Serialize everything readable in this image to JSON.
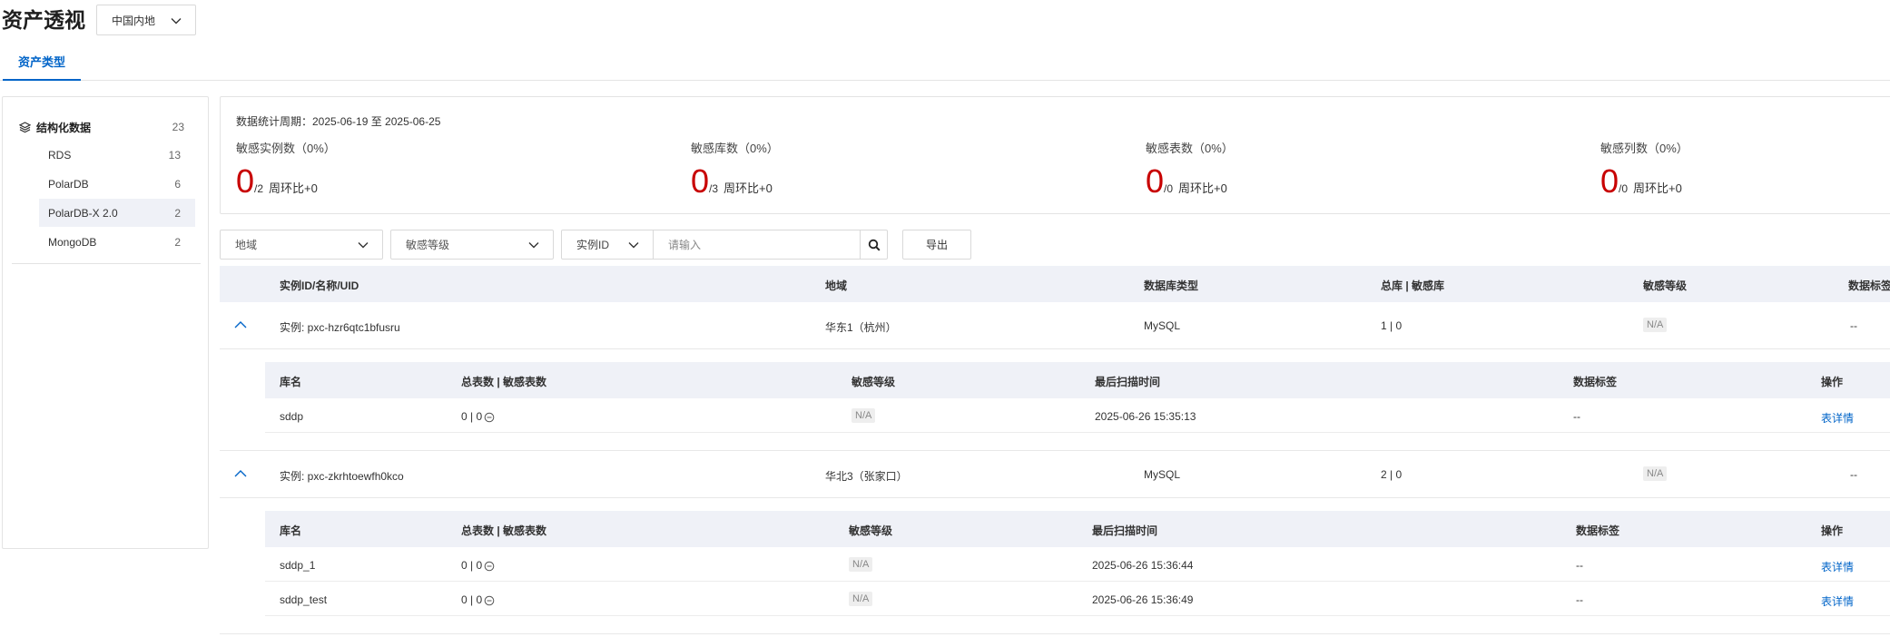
{
  "header": {
    "title": "资产透视",
    "region_value": "中国内地"
  },
  "tabs": [
    {
      "label": "资产类型",
      "active": true
    }
  ],
  "sidebar": {
    "root": {
      "label": "结构化数据",
      "count": "23",
      "icon": "layers-icon"
    },
    "items": [
      {
        "label": "RDS",
        "count": "13"
      },
      {
        "label": "PolarDB",
        "count": "6"
      },
      {
        "label": "PolarDB-X 2.0",
        "count": "2",
        "selected": true
      },
      {
        "label": "MongoDB",
        "count": "2"
      }
    ]
  },
  "stats": {
    "period": "数据统计周期：2025-06-19 至 2025-06-25",
    "cards": [
      {
        "label": "敏感实例数（0%）",
        "value": "0",
        "total": "/2",
        "week": "周环比+0"
      },
      {
        "label": "敏感库数（0%）",
        "value": "0",
        "total": "/3",
        "week": "周环比+0"
      },
      {
        "label": "敏感表数（0%）",
        "value": "0",
        "total": "/0",
        "week": "周环比+0"
      },
      {
        "label": "敏感列数（0%）",
        "value": "0",
        "total": "/0",
        "week": "周环比+0"
      }
    ],
    "value_color": "#c80000"
  },
  "filters": {
    "region_placeholder": "地域",
    "level_placeholder": "敏感等级",
    "id_select": "实例ID",
    "search_placeholder": "请输入",
    "export_label": "导出"
  },
  "table": {
    "headers": [
      "实例ID/名称/UID",
      "地域",
      "数据库类型",
      "总库 | 敏感库",
      "敏感等级",
      "数据标签"
    ],
    "sub_headers": [
      "库名",
      "总表数 | 敏感表数",
      "敏感等级",
      "最后扫描时间",
      "数据标签",
      "操作"
    ],
    "instances": [
      {
        "instance": "实例: pxc-hzr6qtc1bfusru",
        "region": "华东1（杭州）",
        "db_type": "MySQL",
        "db_counts": "1 | 0",
        "level": "N/A",
        "tags": "--",
        "databases": [
          {
            "name": "sddp",
            "tables": "0 | 0",
            "level": "N/A",
            "scan_time": "2025-06-26 15:35:13",
            "tags": "--",
            "action": "表详情"
          }
        ]
      },
      {
        "instance": "实例: pxc-zkrhtoewfh0kco",
        "region": "华北3（张家口）",
        "db_type": "MySQL",
        "db_counts": "2 | 0",
        "level": "N/A",
        "tags": "--",
        "databases": [
          {
            "name": "sddp_1",
            "tables": "0 | 0",
            "level": "N/A",
            "scan_time": "2025-06-26 15:36:44",
            "tags": "--",
            "action": "表详情"
          },
          {
            "name": "sddp_test",
            "tables": "0 | 0",
            "level": "N/A",
            "scan_time": "2025-06-26 15:36:49",
            "tags": "--",
            "action": "表详情"
          }
        ]
      }
    ]
  },
  "colors": {
    "accent": "#0064c8",
    "header_bg": "#eff1f7",
    "alert": "#c80000"
  }
}
